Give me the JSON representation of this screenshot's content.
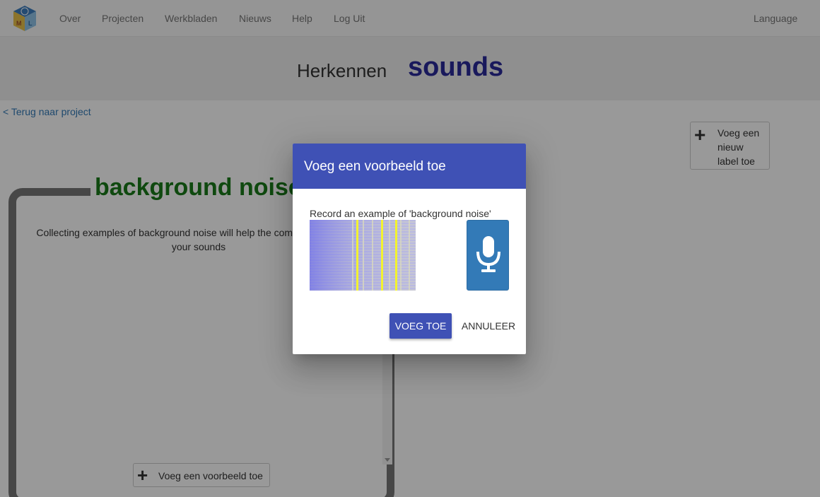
{
  "nav": {
    "items": [
      "Over",
      "Projecten",
      "Werkbladen",
      "Nieuws",
      "Help",
      "Log Uit"
    ],
    "language": "Language"
  },
  "header": {
    "prefix": "Herkennen",
    "project_name": "sounds"
  },
  "back_link": "< Terug naar project",
  "add_label_button": "Voeg een nieuw label toe",
  "bucket": {
    "title": "background noise",
    "description": "Collecting examples of background noise will help the computer recognize your sounds",
    "add_example_button": "Voeg een voorbeeld toe"
  },
  "dialog": {
    "title": "Voeg een voorbeeld toe",
    "prompt": "Record an example of 'background noise'",
    "add_button": "VOEG TOE",
    "cancel_button": "ANNULEER",
    "mic_icon": "microphone-icon"
  },
  "colors": {
    "dialog_header": "#3f51b5",
    "project_name": "#2a2a9a",
    "label_title": "#1a7a1a",
    "mic_button": "#337ab7",
    "link": "#337ab7"
  }
}
